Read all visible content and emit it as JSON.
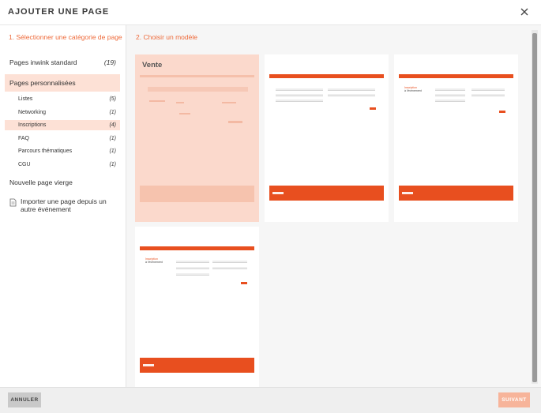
{
  "modal": {
    "title": "AJOUTER UNE PAGE"
  },
  "steps": {
    "step1": "1. Sélectionner une catégorie de page",
    "step2": "2. Choisir un modèle"
  },
  "categories": [
    {
      "label": "Pages inwink standard",
      "count": "(19)"
    },
    {
      "label": "Pages personnalisées"
    }
  ],
  "subcategories": [
    {
      "label": "Listes",
      "count": "(5)"
    },
    {
      "label": "Networking",
      "count": "(1)"
    },
    {
      "label": "Inscriptions",
      "count": "(4)"
    },
    {
      "label": "FAQ",
      "count": "(1)"
    },
    {
      "label": "Parcours thématiques",
      "count": "(1)"
    },
    {
      "label": "CGU",
      "count": "(1)"
    }
  ],
  "blank_page": "Nouvelle page vierge",
  "import_page": "Importer une page depuis un autre événement",
  "templates": [
    {
      "title": "Vente"
    },
    {
      "title": ""
    },
    {
      "heading": "Inscription",
      "subheading": "à l'événement"
    },
    {
      "heading": "Inscription",
      "subheading": "à l'événement"
    }
  ],
  "footer": {
    "cancel": "ANNULER",
    "next": "SUIVANT"
  },
  "colors": {
    "accent": "#ee6a3a",
    "selected_bg": "#fde1d6",
    "next_disabled": "#f7b49a"
  }
}
